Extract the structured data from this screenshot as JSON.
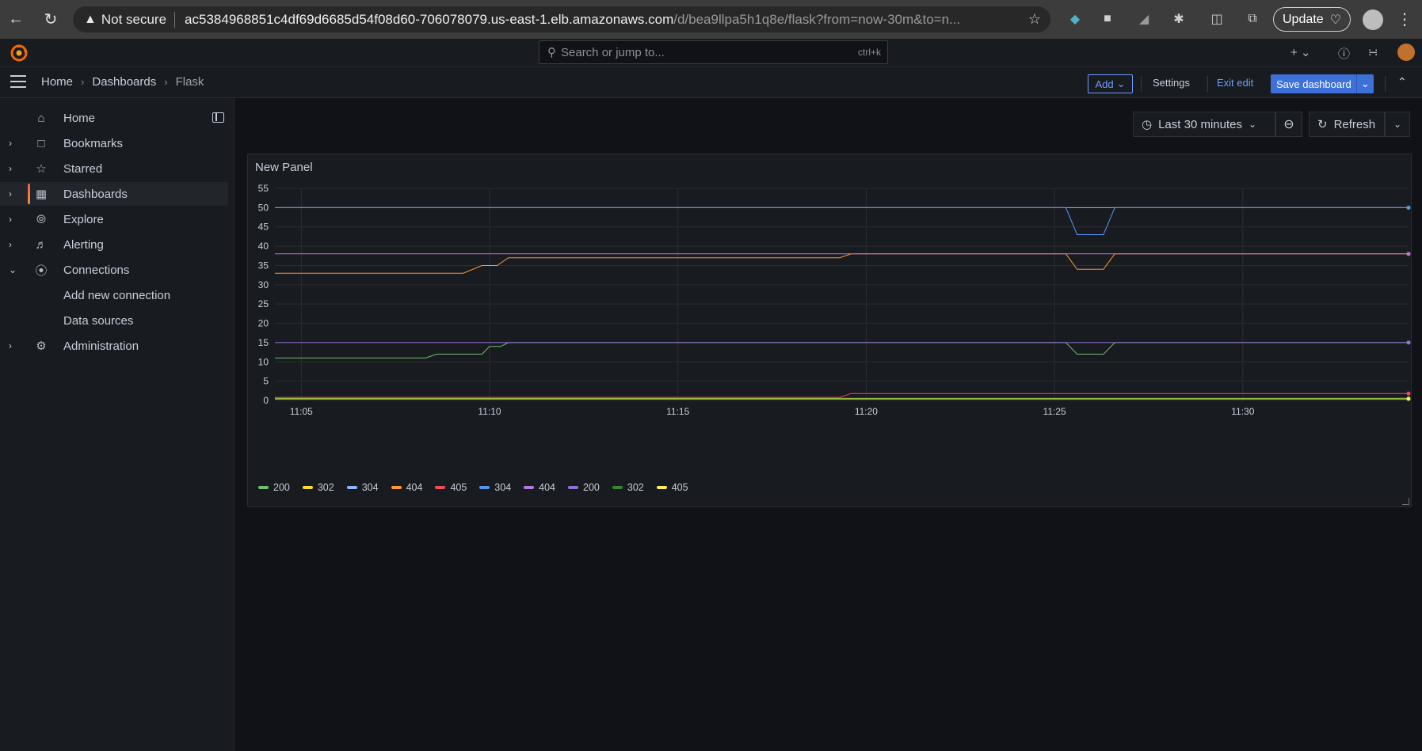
{
  "browser": {
    "security_label": "Not secure",
    "url_host": "ac5384968851c4df69d6685d54f08d60-706078079.us-east-1.elb.amazonaws.com",
    "url_path": "/d/bea9llpa5h1q8e/flask?from=now-30m&to=n...",
    "update_label": "Update"
  },
  "topbar": {
    "search_placeholder": "Search or jump to...",
    "search_shortcut": "ctrl+k"
  },
  "breadcrumb": {
    "items": [
      "Home",
      "Dashboards",
      "Flask"
    ]
  },
  "toolbar": {
    "add_label": "Add",
    "settings_label": "Settings",
    "exit_edit_label": "Exit edit",
    "save_label": "Save dashboard"
  },
  "sidebar": {
    "items": [
      {
        "label": "Home",
        "icon": "home-icon",
        "expand": ""
      },
      {
        "label": "Bookmarks",
        "icon": "bookmark-icon",
        "expand": "right"
      },
      {
        "label": "Starred",
        "icon": "star-icon",
        "expand": "right"
      },
      {
        "label": "Dashboards",
        "icon": "apps-icon",
        "expand": "right",
        "active": true
      },
      {
        "label": "Explore",
        "icon": "compass-icon",
        "expand": "right"
      },
      {
        "label": "Alerting",
        "icon": "bell-icon",
        "expand": "right"
      },
      {
        "label": "Connections",
        "icon": "connections-icon",
        "expand": "down"
      },
      {
        "label": "Add new connection",
        "icon": "",
        "expand": "",
        "sub": true
      },
      {
        "label": "Data sources",
        "icon": "",
        "expand": "",
        "sub": true
      },
      {
        "label": "Administration",
        "icon": "cog-icon",
        "expand": "right"
      }
    ]
  },
  "timepicker": {
    "range_label": "Last 30 minutes",
    "refresh_label": "Refresh"
  },
  "panel": {
    "title": "New Panel"
  },
  "chart_data": {
    "type": "line",
    "title": "New Panel",
    "xlabel": "",
    "ylabel": "",
    "x_ticks": [
      "11:05",
      "11:10",
      "11:15",
      "11:20",
      "11:25",
      "11:30"
    ],
    "y_ticks": [
      0,
      5,
      10,
      15,
      20,
      25,
      30,
      35,
      40,
      45,
      50,
      55
    ],
    "ylim": [
      0,
      55
    ],
    "x_minutes_range": [
      "11:04.3",
      "11:34.4"
    ],
    "grid": true,
    "legend_position": "bottom",
    "series": [
      {
        "name": "200",
        "color": "#73bf69",
        "points": [
          [
            "11:04.3",
            11
          ],
          [
            "11:08.3",
            11
          ],
          [
            "11:08.6",
            12
          ],
          [
            "11:09.8",
            12
          ],
          [
            "11:10.0",
            14
          ],
          [
            "11:10.3",
            14
          ],
          [
            "11:10.5",
            15
          ],
          [
            "11:25.3",
            15
          ],
          [
            "11:25.6",
            12
          ],
          [
            "11:26.3",
            12
          ],
          [
            "11:26.6",
            15
          ],
          [
            "11:34.4",
            15
          ]
        ]
      },
      {
        "name": "302",
        "color": "#fade2a",
        "points": [
          [
            "11:04.3",
            0.5
          ],
          [
            "11:34.4",
            0.5
          ]
        ]
      },
      {
        "name": "304",
        "color": "#8ab8ff",
        "points": [
          [
            "11:04.3",
            50
          ],
          [
            "11:34.4",
            50
          ]
        ]
      },
      {
        "name": "404",
        "color": "#ff9830",
        "points": [
          [
            "11:04.3",
            33
          ],
          [
            "11:09.3",
            33
          ],
          [
            "11:09.8",
            35
          ],
          [
            "11:10.2",
            35
          ],
          [
            "11:10.5",
            37
          ],
          [
            "11:19.3",
            37
          ],
          [
            "11:19.6",
            38
          ],
          [
            "11:25.3",
            38
          ],
          [
            "11:25.6",
            34
          ],
          [
            "11:26.3",
            34
          ],
          [
            "11:26.6",
            38
          ],
          [
            "11:34.4",
            38
          ]
        ]
      },
      {
        "name": "405",
        "color": "#f2495c",
        "points": [
          [
            "11:04.3",
            0.8
          ],
          [
            "11:19.3",
            0.8
          ],
          [
            "11:19.6",
            1.8
          ],
          [
            "11:34.4",
            1.8
          ]
        ]
      },
      {
        "name": "304",
        "color": "#5794f2",
        "points": [
          [
            "11:04.3",
            50
          ],
          [
            "11:25.3",
            50
          ],
          [
            "11:25.6",
            43
          ],
          [
            "11:26.3",
            43
          ],
          [
            "11:26.6",
            50
          ],
          [
            "11:34.4",
            50
          ]
        ]
      },
      {
        "name": "404",
        "color": "#b877d9",
        "points": [
          [
            "11:04.3",
            38
          ],
          [
            "11:34.4",
            38
          ]
        ]
      },
      {
        "name": "200",
        "color": "#8f72d9",
        "points": [
          [
            "11:04.3",
            15
          ],
          [
            "11:34.4",
            15
          ]
        ]
      },
      {
        "name": "302",
        "color": "#37872d",
        "points": [
          [
            "11:04.3",
            0.6
          ],
          [
            "11:34.4",
            0.6
          ]
        ]
      },
      {
        "name": "405",
        "color": "#ffee52",
        "points": [
          [
            "11:04.3",
            0.4
          ],
          [
            "11:34.4",
            0.4
          ]
        ]
      }
    ]
  },
  "colors": {
    "background": "#111217",
    "panel": "#181b1f",
    "accent_blue": "#3d71d9",
    "link_blue": "#6e9fff",
    "active_bar": "#f55f3e"
  }
}
